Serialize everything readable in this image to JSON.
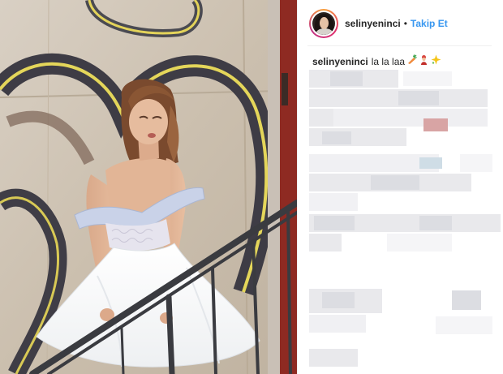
{
  "post": {
    "username": "selinyeninci",
    "separator": "•",
    "follow_label": "Takip Et",
    "caption_user": "selinyeninci",
    "caption_text": "la la laa",
    "caption_emojis": [
      "carrot-emoji",
      "genie-emoji",
      "sparkle-emoji"
    ]
  },
  "colors": {
    "follow": "#3897f0",
    "text": "#262626",
    "divider": "#efefef"
  }
}
